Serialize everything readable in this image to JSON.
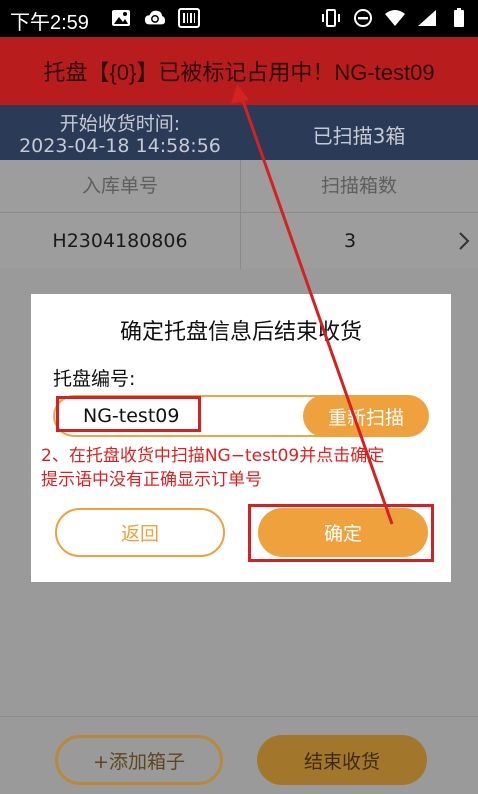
{
  "status_bar": {
    "time": "下午2:59",
    "left_icons": [
      "image-icon",
      "cloud-sync-icon",
      "barcode-icon"
    ],
    "right_icons": [
      "vibrate-icon",
      "do-not-disturb-icon",
      "wifi-icon",
      "signal-icon",
      "battery-icon"
    ]
  },
  "banner": {
    "message": "托盘【{0}】已被标记占用中！NG-test09",
    "color": "#b91c1c"
  },
  "info_bar": {
    "start_label": "开始收货时间:",
    "start_time": "2023-04-18 14:58:56",
    "scanned_count": "已扫描3箱"
  },
  "table": {
    "headers": [
      "入库单号",
      "扫描箱数"
    ],
    "rows": [
      {
        "order_no": "H2304180806",
        "box_count": "3"
      }
    ]
  },
  "dialog": {
    "title": "确定托盘信息后结束收货",
    "pallet_label": "托盘编号:",
    "pallet_value": "NG-test09",
    "rescan_label": "重新扫描",
    "annotation_line1": "2、在托盘收货中扫描NG−test09并点击确定",
    "annotation_line2": "提示语中没有正确显示订单号",
    "back_label": "返回",
    "ok_label": "确定",
    "accent_color": "#eea13c",
    "highlight_color": "#d32222"
  },
  "footer": {
    "add_box_label": "+添加箱子",
    "end_receive_label": "结束收货"
  }
}
